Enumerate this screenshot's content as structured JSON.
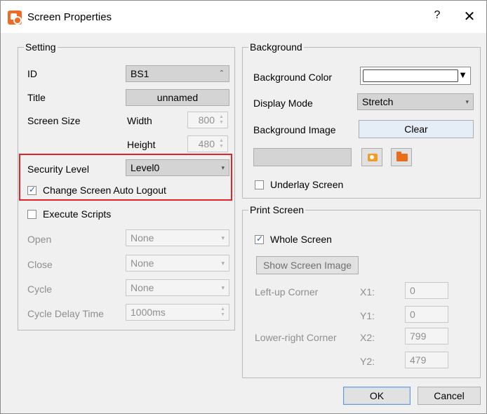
{
  "window": {
    "title": "Screen Properties",
    "help": "?",
    "close": "✕"
  },
  "setting": {
    "legend": "Setting",
    "id_label": "ID",
    "id_value": "BS1",
    "title_label": "Title",
    "title_value": "unnamed",
    "screen_size_label": "Screen Size",
    "width_label": "Width",
    "width_value": "800",
    "height_label": "Height",
    "height_value": "480",
    "security_label": "Security Level",
    "security_value": "Level0",
    "auto_logout_label": "Change Screen Auto Logout",
    "auto_logout_checked": true,
    "execute_scripts_label": "Execute Scripts",
    "execute_scripts_checked": false,
    "open_label": "Open",
    "open_value": "None",
    "close_label": "Close",
    "close_value": "None",
    "cycle_label": "Cycle",
    "cycle_value": "None",
    "cycle_delay_label": "Cycle Delay Time",
    "cycle_delay_value": "1000ms"
  },
  "background": {
    "legend": "Background",
    "color_label": "Background Color",
    "display_mode_label": "Display Mode",
    "display_mode_value": "Stretch",
    "image_label": "Background Image",
    "clear_label": "Clear",
    "underlay_label": "Underlay Screen",
    "underlay_checked": false
  },
  "print": {
    "legend": "Print Screen",
    "whole_label": "Whole Screen",
    "whole_checked": true,
    "show_image_label": "Show Screen Image",
    "left_up_label": "Left-up Corner",
    "x1_label": "X1:",
    "x1_value": "0",
    "y1_label": "Y1:",
    "y1_value": "0",
    "lower_right_label": "Lower-right Corner",
    "x2_label": "X2:",
    "x2_value": "799",
    "y2_label": "Y2:",
    "y2_value": "479"
  },
  "footer": {
    "ok_label": "OK",
    "cancel_label": "Cancel"
  },
  "colors": {
    "highlight": "#e0242b",
    "accent": "#1f5fbf",
    "app_icon": "#f26a22"
  }
}
